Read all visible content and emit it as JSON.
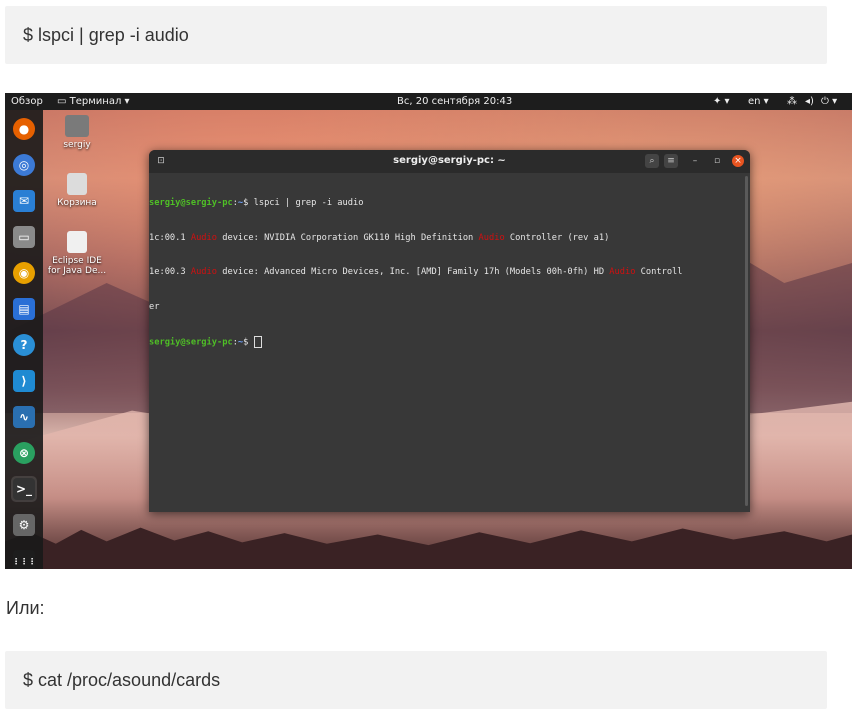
{
  "code_block_1": {
    "command": "$  lspci | grep -i audio"
  },
  "paragraph": "Или:",
  "code_block_2": {
    "command": "$  cat /proc/asound/cards"
  },
  "screenshot": {
    "topbar": {
      "overview": "Обзор",
      "app_menu": "▭ Терминал ▾",
      "clock": "Вс, 20 сентября  20:43",
      "accessibility": "✦ ▾",
      "language": "en ▾",
      "network_icon": "network-icon",
      "volume_icon": "volume-icon",
      "power": "⏻ ▾"
    },
    "dock": [
      {
        "name": "firefox-icon",
        "glyph": "●",
        "color": "#e66000"
      },
      {
        "name": "chromium-icon",
        "glyph": "◎",
        "color": "#3c7ad6"
      },
      {
        "name": "thunderbird-icon",
        "glyph": "✉",
        "color": "#2a7fd4"
      },
      {
        "name": "files-icon",
        "glyph": "▭",
        "color": "#8a8a8a"
      },
      {
        "name": "rhythmbox-icon",
        "glyph": "◉",
        "color": "#e8a000"
      },
      {
        "name": "writer-icon",
        "glyph": "▤",
        "color": "#2a6fd6"
      },
      {
        "name": "help-icon",
        "glyph": "?",
        "color": "#2a8fd6"
      },
      {
        "name": "vscode-icon",
        "glyph": "⟩",
        "color": "#1f8ad2"
      },
      {
        "name": "system-monitor-icon",
        "glyph": "∿",
        "color": "#2a6fb0"
      },
      {
        "name": "software-icon",
        "glyph": "⊗",
        "color": "#2aa060"
      },
      {
        "name": "terminal-icon",
        "glyph": ">_",
        "color": "#333333"
      },
      {
        "name": "settings-icon",
        "glyph": "⚙",
        "color": "#666666"
      },
      {
        "name": "show-apps-icon",
        "glyph": "⋮⋮⋮",
        "color": "#1d1d1d"
      }
    ],
    "desktop_icons": [
      {
        "name": "desktop-icon-home",
        "label": "sergiy"
      },
      {
        "name": "desktop-icon-trash",
        "label": "Корзина"
      },
      {
        "name": "desktop-icon-eclipse",
        "label": "Eclipse IDE for Java De..."
      }
    ],
    "terminal": {
      "title": "sergiy@sergiy-pc: ~",
      "prompt_user": "sergiy@sergiy-pc",
      "prompt_path": "~",
      "command": " lspci | grep -i audio",
      "line1_a": "1c:00.1 ",
      "line1_hl1": "Audio",
      "line1_b": " device: NVIDIA Corporation GK110 High Definition ",
      "line1_hl2": "Audio",
      "line1_c": " Controller (rev a1)",
      "line2_a": "1e:00.3 ",
      "line2_hl1": "Audio",
      "line2_b": " device: Advanced Micro Devices, Inc. [AMD] Family 17h (Models 00h-0fh) HD ",
      "line2_hl2": "Audio",
      "line2_c": " Controll",
      "line3": "er"
    }
  }
}
